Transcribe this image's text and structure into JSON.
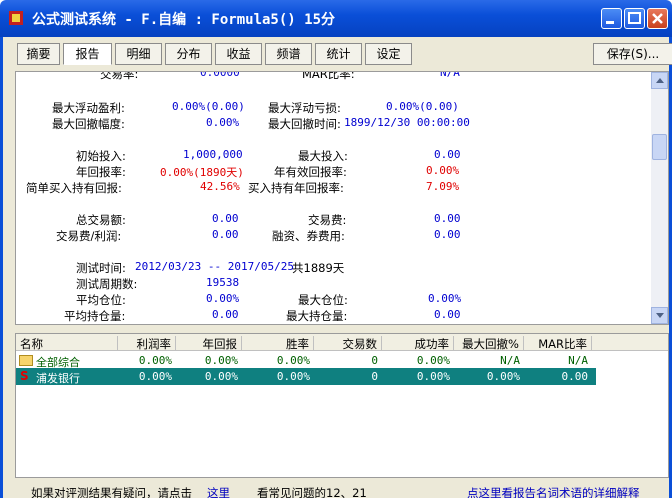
{
  "window": {
    "title": "公式测试系统 - F.自编 : Formula5() 15分"
  },
  "tabs": [
    "摘要",
    "报告",
    "明细",
    "分布",
    "收益",
    "频谱",
    "统计",
    "设定"
  ],
  "save_button": "保存(S)...",
  "report": {
    "cut_row": {
      "l1": "交易率:",
      "v1": "0.0000",
      "l2": "MAR比率:",
      "v2": "N/A"
    },
    "rows": [
      {
        "l1": "最大浮动盈利:",
        "v1": "0.00%(0.00)",
        "l2": "最大浮动亏损:",
        "v2": "0.00%(0.00)"
      },
      {
        "l1": "最大回撤幅度:",
        "v1": "0.00%",
        "l2": "最大回撤时间:",
        "v2": "1899/12/30 00:00:00"
      },
      {
        "l1": "初始投入:",
        "v1": "1,000,000",
        "l2": "最大投入:",
        "v2": "0.00"
      },
      {
        "l1": "年回报率:",
        "v1": "0.00%(1890天)",
        "l2": "年有效回报率:",
        "v2": "0.00%"
      },
      {
        "l1": "简单买入持有回报:",
        "v1": "42.56%",
        "l2": "买入持有年回报率:",
        "v2": "7.09%"
      },
      {
        "l1": "总交易额:",
        "v1": "0.00",
        "l2": "交易费:",
        "v2": "0.00"
      },
      {
        "l1": "交易费/利润:",
        "v1": "0.00",
        "l2": "融资、券费用:",
        "v2": "0.00"
      },
      {
        "l1": "测试时间:",
        "v1": "2012/03/23 -- 2017/05/25",
        "extra": "共1889天"
      },
      {
        "l1": "测试周期数:",
        "v1": "19538"
      },
      {
        "l1": "平均仓位:",
        "v1": "0.00%",
        "l2": "最大仓位:",
        "v2": "0.00%"
      },
      {
        "l1": "平均持仓量:",
        "v1": "0.00",
        "l2": "最大持仓量:",
        "v2": "0.00"
      }
    ]
  },
  "grid": {
    "columns": [
      "名称",
      "利润率",
      "年回报",
      "胜率",
      "交易数",
      "成功率",
      "最大回撤%",
      "MAR比率"
    ],
    "rows": [
      {
        "name": "全部综合",
        "cells": [
          "0.00%",
          "0.00%",
          "0.00%",
          "0",
          "0.00%",
          "N/A",
          "N/A"
        ]
      },
      {
        "name": "浦发银行",
        "cells": [
          "0.00%",
          "0.00%",
          "0.00%",
          "0",
          "0.00%",
          "0.00%",
          "0.00"
        ]
      }
    ]
  },
  "footer": {
    "text1": "如果对评测结果有疑问，请点击",
    "link1": "这里",
    "text2": "看常见问题的12、21",
    "link2": "点这里看报告名词术语的详细解释"
  },
  "colors": {
    "title_bar": "#0a4fd8",
    "selected_row": "#0f8080",
    "value_blue": "#0000d0",
    "value_red": "#e00000"
  }
}
